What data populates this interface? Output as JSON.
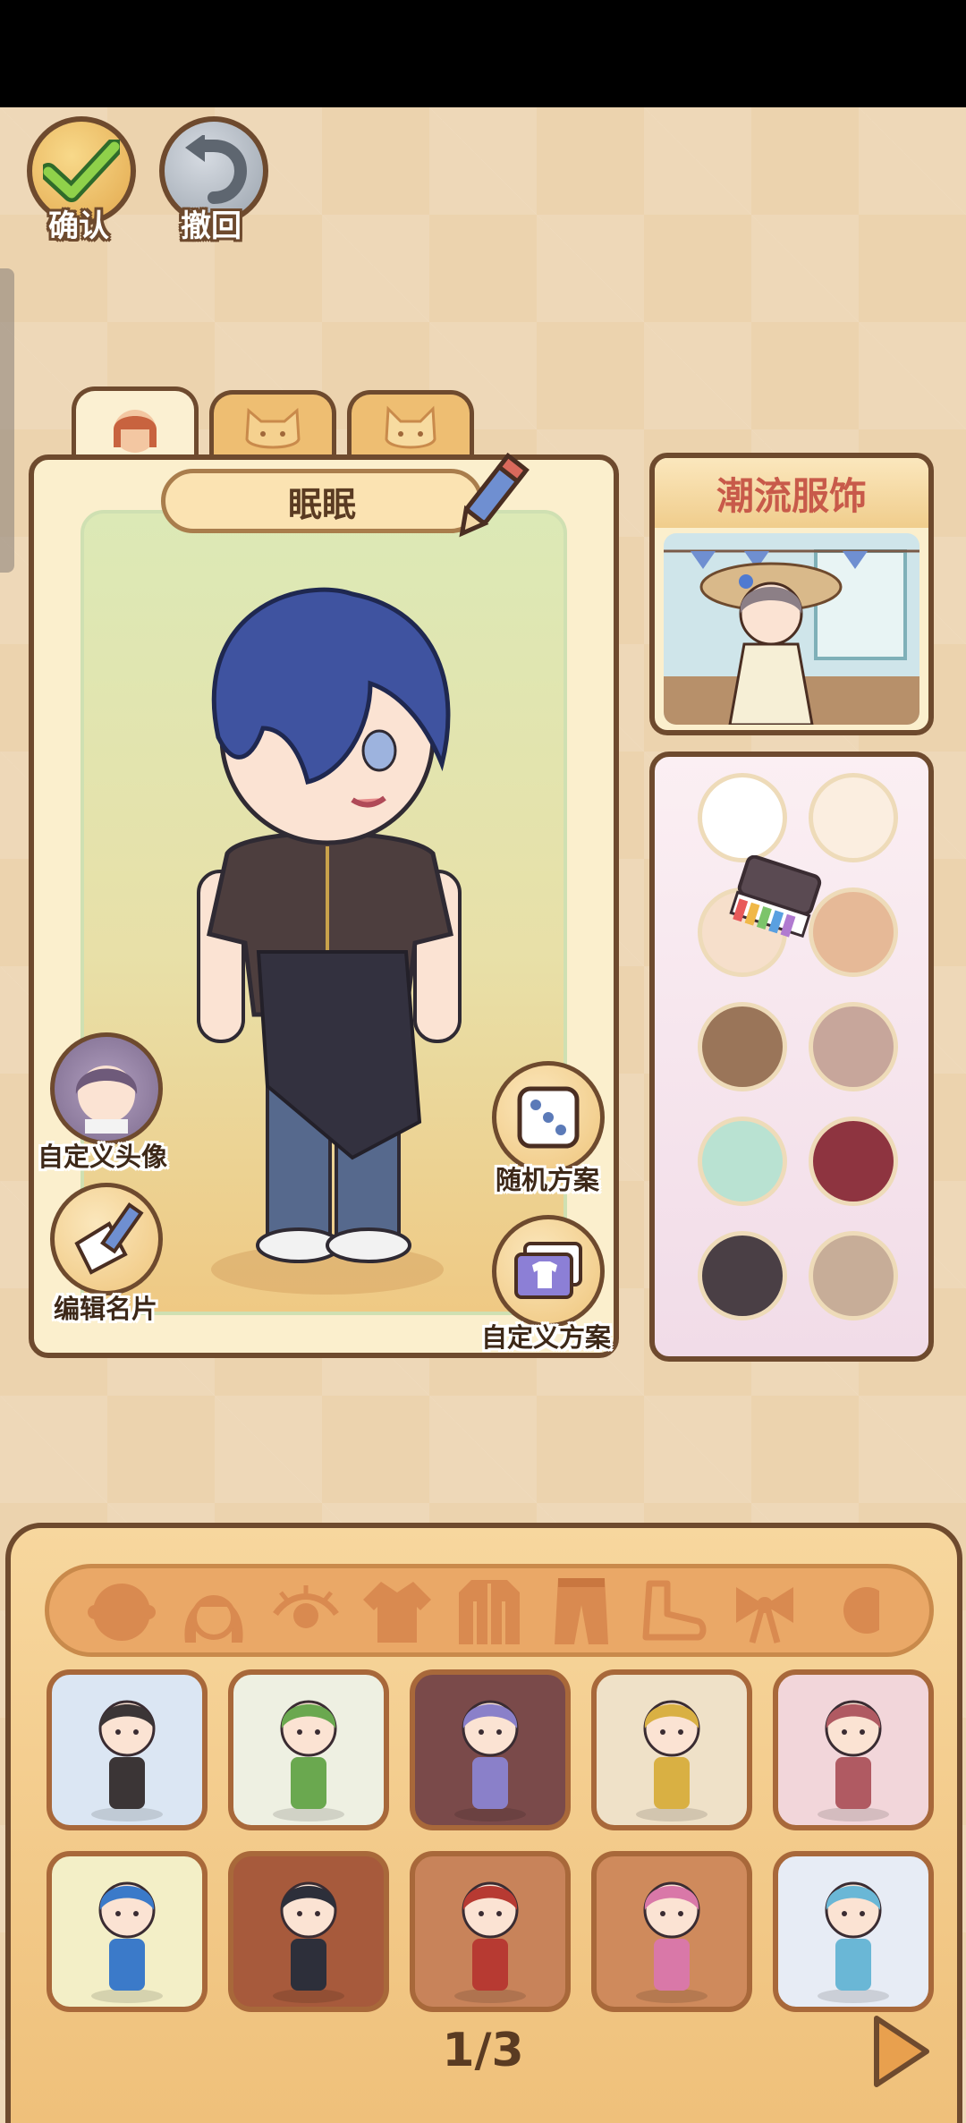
{
  "top_actions": {
    "confirm_label": "确认",
    "undo_label": "撤回"
  },
  "character_tabs": [
    {
      "icon": "girl-face-icon",
      "active": true
    },
    {
      "icon": "cat-face-icon",
      "active": false
    },
    {
      "icon": "dog-face-icon",
      "active": false
    }
  ],
  "character": {
    "name": "眠眠"
  },
  "tools": {
    "custom_avatar_label": "自定义头像",
    "edit_card_label": "编辑名片",
    "random_plan_label": "随机方案",
    "custom_plan_label": "自定义方案"
  },
  "fashion": {
    "title": "潮流服饰"
  },
  "palette": {
    "colors": [
      "#ffffff",
      "#fbeee0",
      "#f6dfcb",
      "#e6b997",
      "#9a7559",
      "#c7a69b",
      "#b9e2d2",
      "#8e3440",
      "#4a3f45",
      "#c7ad98"
    ]
  },
  "wardrobe": {
    "categories": [
      "face-icon",
      "hair-icon",
      "eye-icon",
      "shirt-icon",
      "coat-icon",
      "pants-icon",
      "shoe-icon",
      "bow-icon"
    ],
    "outfits": [
      {
        "name": "outfit-1",
        "bg": "#dbe6f3",
        "accent": "#3b3536"
      },
      {
        "name": "outfit-2",
        "bg": "#eef0e2",
        "accent": "#6aa84f"
      },
      {
        "name": "outfit-3",
        "bg": "#7a4a4a",
        "accent": "#8a80c9"
      },
      {
        "name": "outfit-4",
        "bg": "#efe1c8",
        "accent": "#d9b043"
      },
      {
        "name": "outfit-5",
        "bg": "#f2d6da",
        "accent": "#b05a62"
      },
      {
        "name": "outfit-6",
        "bg": "#f3efc7",
        "accent": "#3b7ac9"
      },
      {
        "name": "outfit-7",
        "bg": "#a75a3c",
        "accent": "#2d2f3a"
      },
      {
        "name": "outfit-8",
        "bg": "#c8835a",
        "accent": "#b73a32"
      },
      {
        "name": "outfit-9",
        "bg": "#cf8a5c",
        "accent": "#d978a8"
      },
      {
        "name": "outfit-10",
        "bg": "#e7ecf5",
        "accent": "#6ab7d6"
      }
    ],
    "page_text": "1/3"
  }
}
